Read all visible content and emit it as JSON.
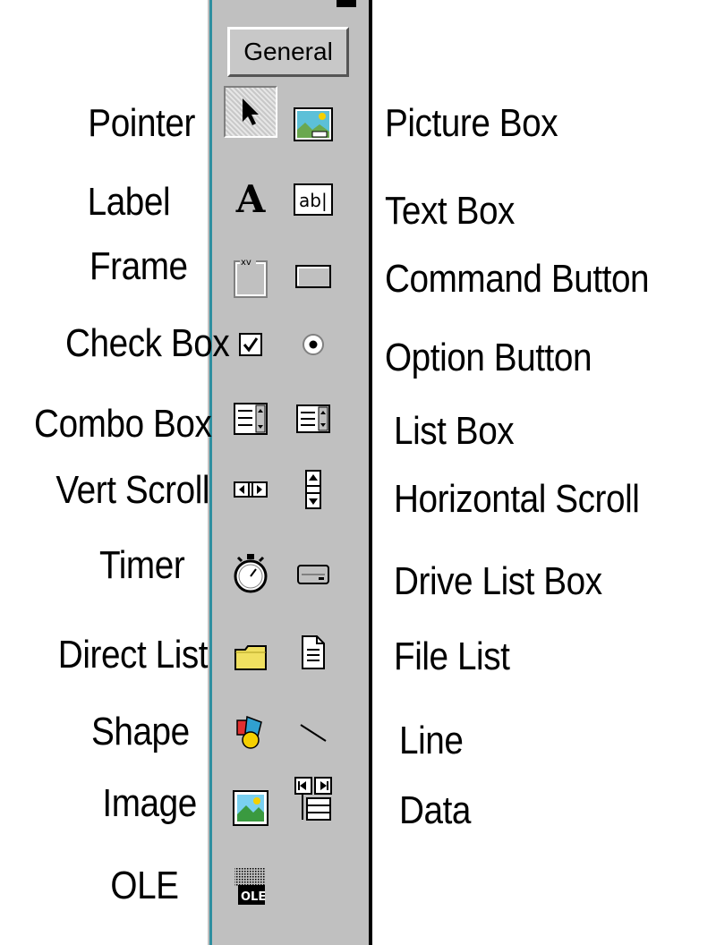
{
  "toolbox": {
    "tab_label": "General"
  },
  "left_labels": [
    "Pointer",
    "Label",
    "Frame",
    "Check Box",
    "Combo Box",
    "Vert Scroll",
    "Timer",
    "Direct  List",
    "Shape",
    "Image",
    "OLE"
  ],
  "right_labels": [
    "Picture Box",
    "Text Box",
    "Command Button",
    "Option Button",
    "List Box",
    "Horizontal Scroll",
    "Drive List Box",
    "File List",
    "Line",
    "Data"
  ],
  "tools": [
    {
      "icon": "pointer-icon"
    },
    {
      "icon": "picture-box-icon"
    },
    {
      "icon": "label-icon",
      "glyph": "A"
    },
    {
      "icon": "text-box-icon",
      "glyph": "ab|"
    },
    {
      "icon": "frame-icon",
      "glyph": "xv"
    },
    {
      "icon": "command-button-icon"
    },
    {
      "icon": "check-box-icon"
    },
    {
      "icon": "option-button-icon"
    },
    {
      "icon": "combo-box-icon"
    },
    {
      "icon": "list-box-icon"
    },
    {
      "icon": "hscroll-icon"
    },
    {
      "icon": "vscroll-icon"
    },
    {
      "icon": "timer-icon"
    },
    {
      "icon": "drive-list-box-icon"
    },
    {
      "icon": "dir-list-box-icon"
    },
    {
      "icon": "file-list-box-icon"
    },
    {
      "icon": "shape-icon"
    },
    {
      "icon": "line-icon"
    },
    {
      "icon": "image-icon"
    },
    {
      "icon": "data-icon"
    },
    {
      "icon": "ole-icon",
      "glyph": "OLE"
    }
  ],
  "colors": {
    "toolbox_bg": "#c0c0c0",
    "accent_line": "#2e8fa0"
  }
}
